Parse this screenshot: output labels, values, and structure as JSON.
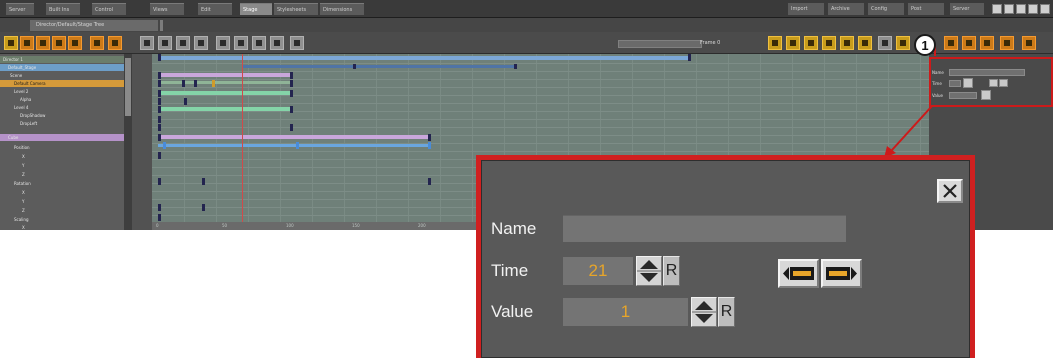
{
  "menubar": {
    "tabs": [
      {
        "label": "Server",
        "active": false
      },
      {
        "label": "Built Ins",
        "active": false
      },
      {
        "label": "Control",
        "active": false
      },
      {
        "label": "Views",
        "active": false
      },
      {
        "label": "Edit",
        "active": false
      },
      {
        "label": "Stage",
        "active": true
      },
      {
        "label": "Stylesheets",
        "active": false
      },
      {
        "label": "Dimensions",
        "active": false
      }
    ],
    "right_tabs": [
      "Import",
      "Archive",
      "Config",
      "Post",
      "Server"
    ]
  },
  "document_tab": "Director/Default/Stage Tree",
  "toolbar": {
    "frame_label": "Frame 0"
  },
  "tree": {
    "rows": [
      {
        "label": "Director 1",
        "style": "plain"
      },
      {
        "label": "Default_Stage",
        "style": "hl-blue"
      },
      {
        "label": "Scene",
        "style": "plain"
      },
      {
        "label": "Default Camera",
        "style": "hl-orange"
      },
      {
        "label": "Level 2",
        "style": "plain"
      },
      {
        "label": "Alpha",
        "style": "plain"
      },
      {
        "label": "Level 4",
        "style": "plain"
      },
      {
        "label": "DropShadow",
        "style": "plain"
      },
      {
        "label": "DropLeft",
        "style": "plain"
      },
      {
        "label": "Cube",
        "style": "hl-purple"
      },
      {
        "label": "Position",
        "style": "plain"
      },
      {
        "label": "X",
        "style": "plain"
      },
      {
        "label": "Y",
        "style": "plain"
      },
      {
        "label": "Z",
        "style": "plain"
      },
      {
        "label": "Rotation",
        "style": "plain"
      },
      {
        "label": "X",
        "style": "plain"
      },
      {
        "label": "Y",
        "style": "plain"
      },
      {
        "label": "Z",
        "style": "plain"
      },
      {
        "label": "Scaling",
        "style": "plain"
      },
      {
        "label": "X",
        "style": "plain"
      }
    ]
  },
  "timeline": {
    "ruler_labels": [
      "0",
      "50",
      "100",
      "150",
      "200"
    ]
  },
  "mini_panel": {
    "name_label": "Name",
    "time_label": "Time",
    "value_label": "Value"
  },
  "callout": {
    "number": "1"
  },
  "zoom_panel": {
    "name_label": "Name",
    "name_value": "",
    "time_label": "Time",
    "time_value": "21",
    "value_label": "Value",
    "value_value": "1",
    "reset_label": "R",
    "close_icon": "close-icon",
    "prev_icon": "prev-keyframe-icon",
    "next_icon": "next-keyframe-icon"
  },
  "colors": {
    "accent_orange": "#e7a52a",
    "callout_red": "#cc1a1a"
  }
}
